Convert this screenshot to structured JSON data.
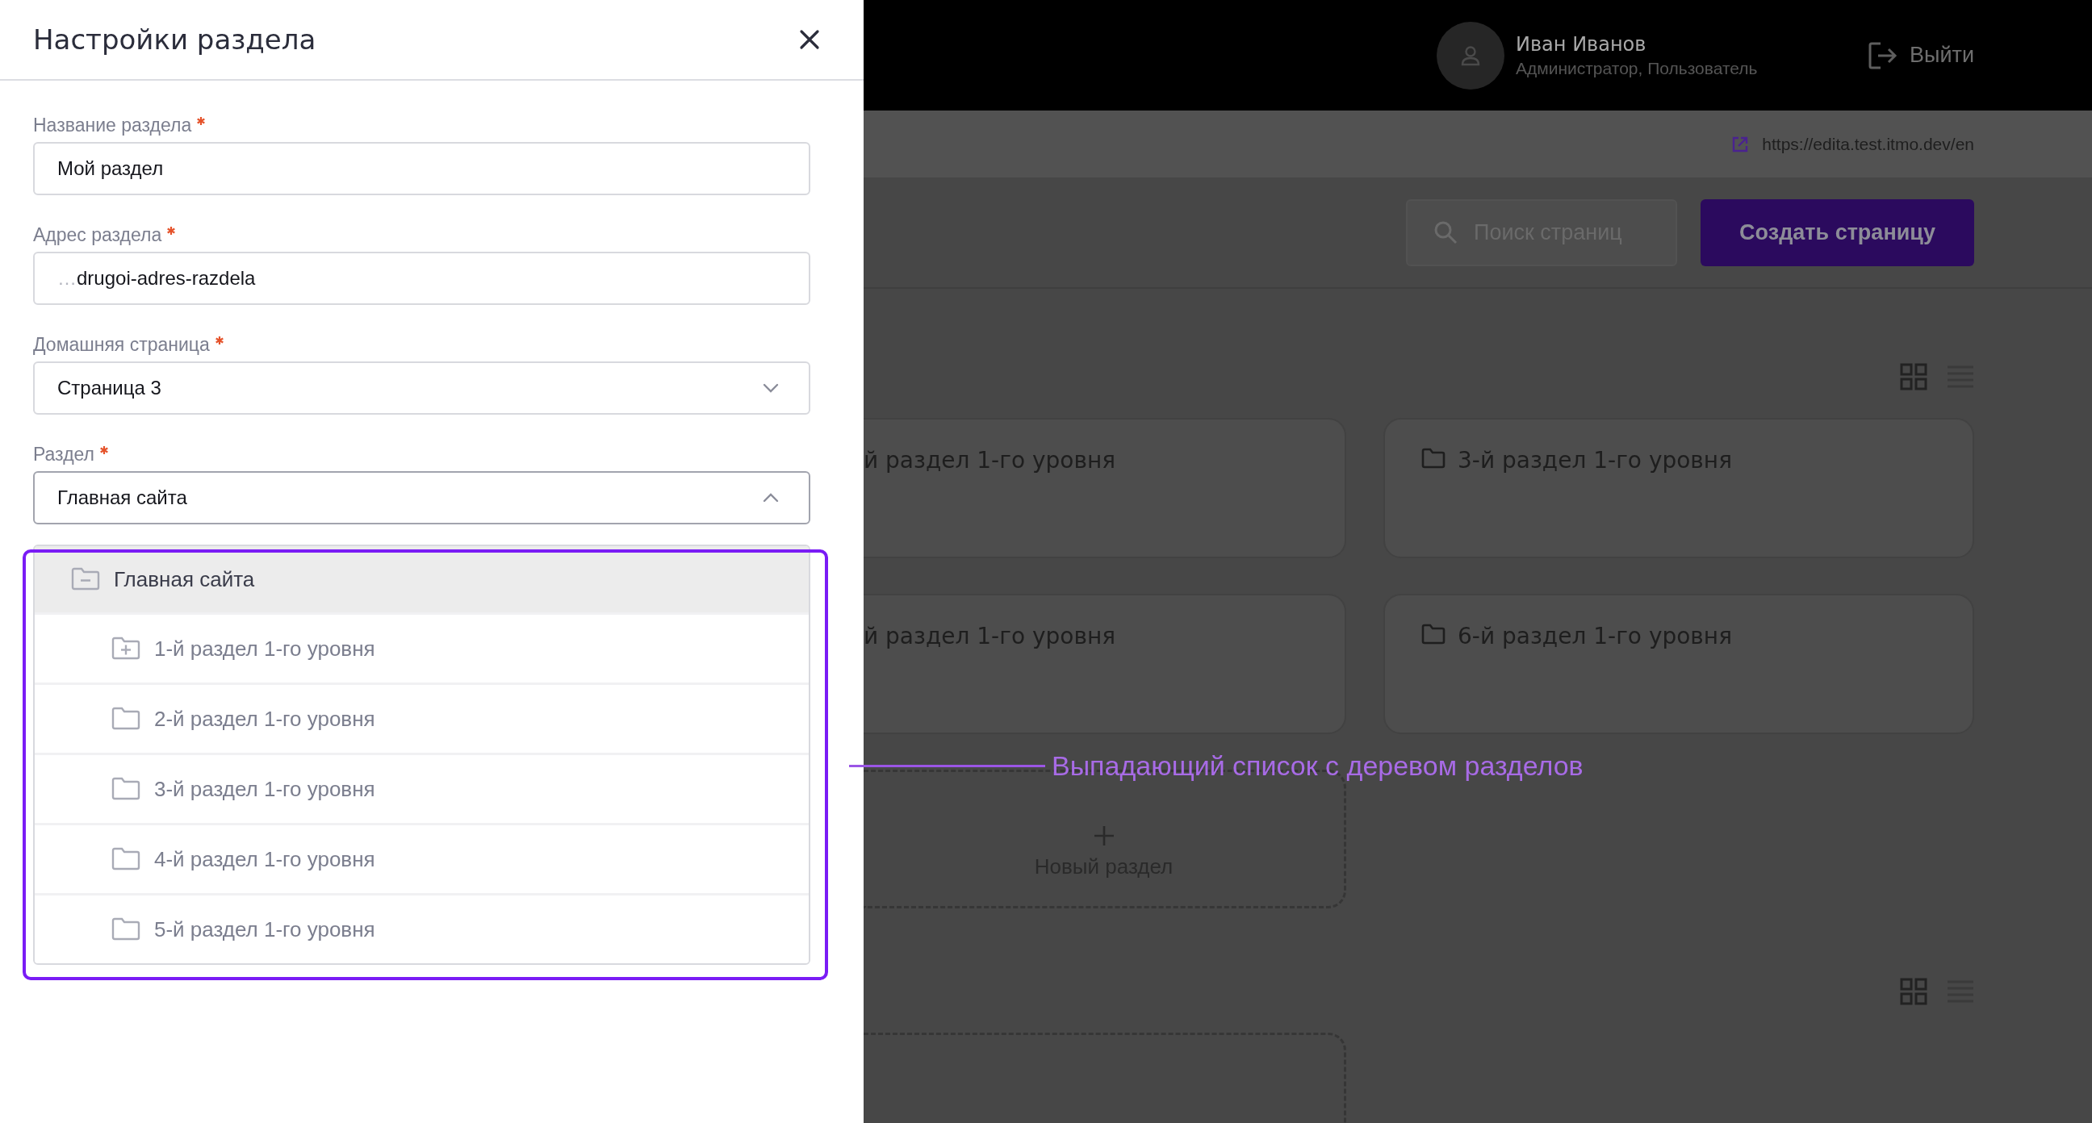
{
  "panel": {
    "title": "Настройки раздела",
    "fields": [
      {
        "label": "Название раздела",
        "required": true,
        "kind": "text",
        "value": "Мой раздел"
      },
      {
        "label": "Адрес раздела",
        "required": true,
        "kind": "text",
        "prefix": "…",
        "value": "drugoi-adres-razdela"
      },
      {
        "label": "Домашняя страница",
        "required": true,
        "kind": "select",
        "expanded": false,
        "value": "Страница 3"
      },
      {
        "label": "Раздел",
        "required": true,
        "kind": "select",
        "expanded": true,
        "value": "Главная сайта"
      }
    ],
    "section_tree": [
      {
        "label": "Главная сайта",
        "kind": "group",
        "expanded": true,
        "selected": true,
        "children": [
          {
            "label": "1-й раздел 1-го уровня",
            "kind": "group",
            "expanded": false,
            "selected": false
          },
          {
            "label": "2-й раздел 1-го уровня",
            "kind": "leaf",
            "selected": false
          },
          {
            "label": "3-й раздел 1-го уровня",
            "kind": "leaf",
            "selected": false
          },
          {
            "label": "4-й раздел 1-го уровня",
            "kind": "leaf",
            "selected": false
          },
          {
            "label": "5-й раздел 1-го уровня",
            "kind": "leaf",
            "selected": false
          }
        ]
      }
    ]
  },
  "annotation": {
    "text": "Выпадающий список с деревом разделов"
  },
  "header": {
    "user_name": "Иван Иванов",
    "user_roles": "Администратор, Пользователь",
    "logout": "Выйти"
  },
  "site_link": "https://edita.test.itmo.dev/en",
  "toolbar": {
    "search_placeholder": "Поиск страниц",
    "create_button": "Создать страницу"
  },
  "sections": [
    {
      "view_modes": [
        {
          "kind": "grid",
          "selected": true
        },
        {
          "kind": "list",
          "selected": false
        }
      ],
      "cards": [
        {
          "kind": "clipped",
          "label": "й раздел 1-го уровня"
        },
        {
          "kind": "folder",
          "label": "3-й раздел 1-го уровня"
        },
        {
          "kind": "clipped",
          "label": "й раздел 1-го уровня"
        },
        {
          "kind": "folder",
          "label": "6-й раздел 1-го уровня"
        },
        {
          "kind": "new",
          "label": "Новый раздел"
        }
      ]
    },
    {
      "view_modes": [
        {
          "kind": "grid",
          "selected": true
        },
        {
          "kind": "list",
          "selected": false
        }
      ],
      "cards": [
        {
          "kind": "new"
        }
      ]
    }
  ]
}
